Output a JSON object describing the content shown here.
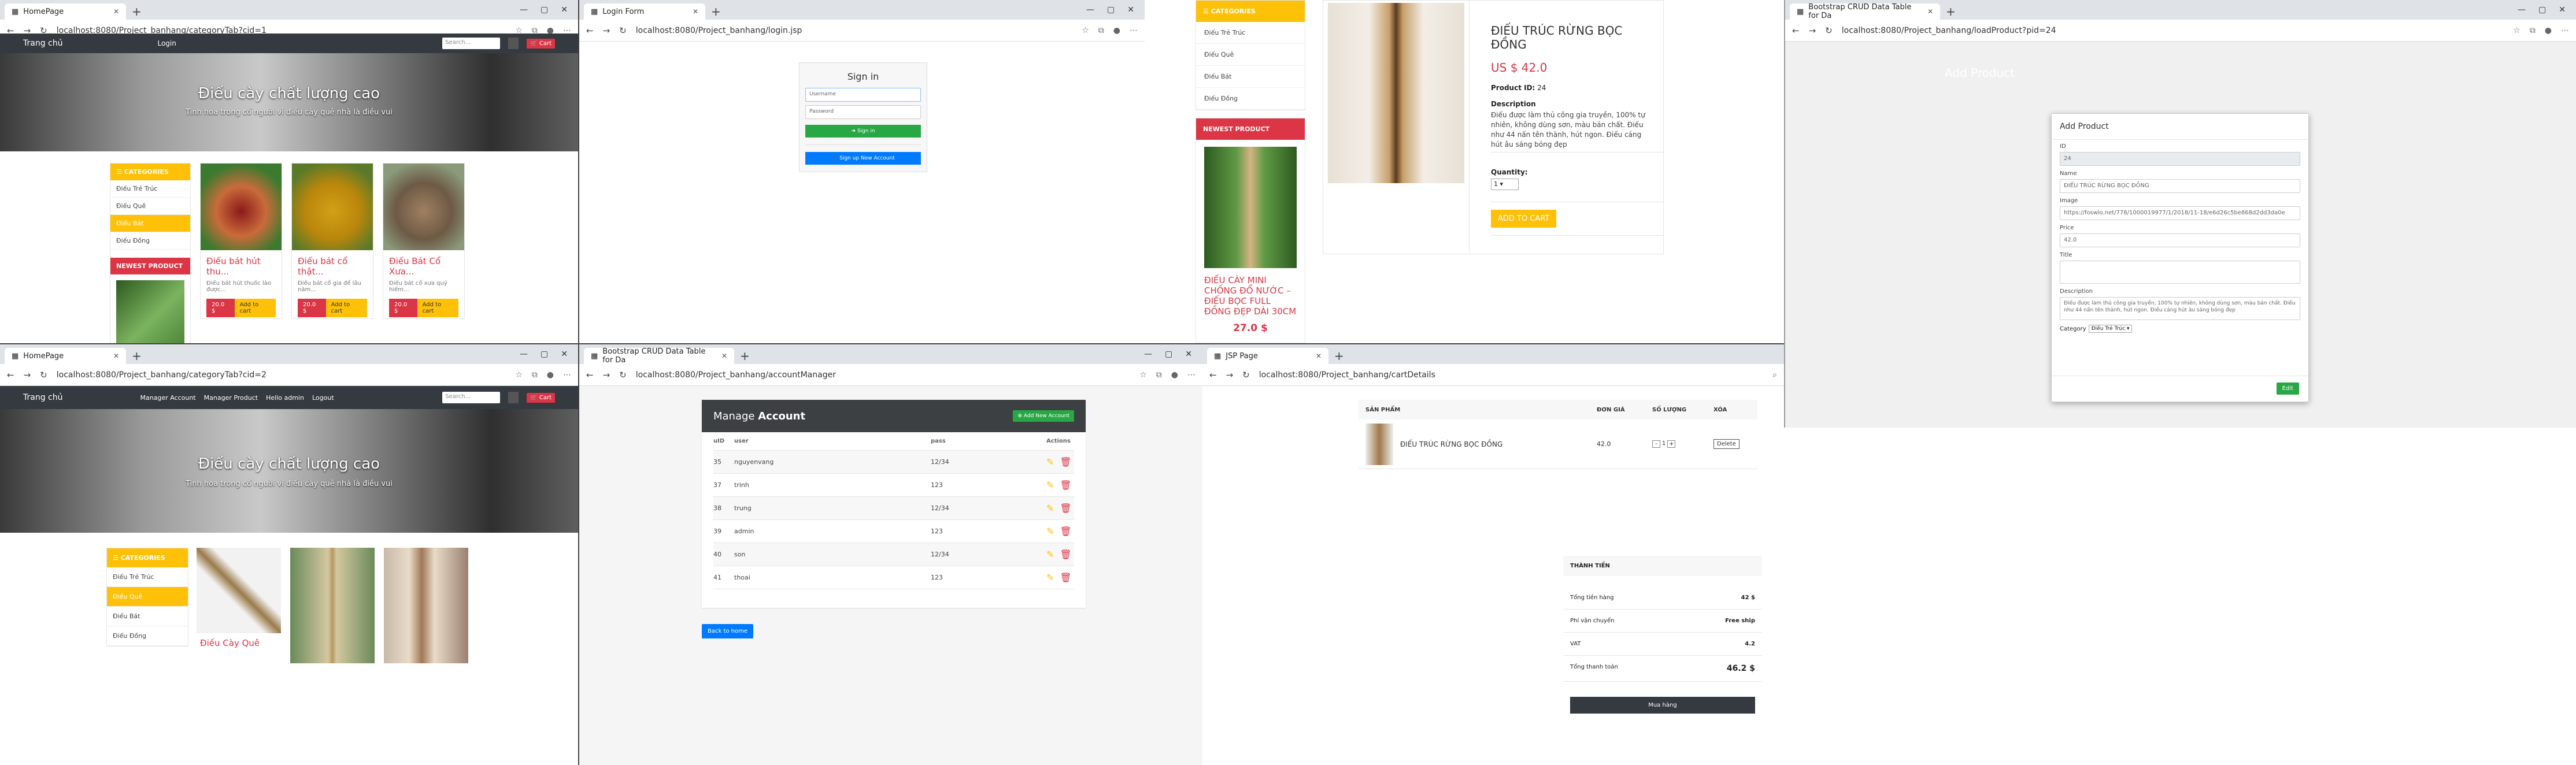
{
  "p1": {
    "tab": "HomePage",
    "url": "localhost:8080/Project_banhang/categoryTab?cid=1",
    "brand": "Trang chủ",
    "login": "Login",
    "search_ph": "Search...",
    "cart": "Cart",
    "hero_title": "Điếu cày chất lượng cao",
    "hero_sub": "Tinh hoa trong cổ người vì điếu cày quê nhà là điều vui",
    "categories_title": "CATEGORIES",
    "categories": [
      "Điếu Trẻ Trúc",
      "Điếu Quê",
      "Điếu Bát",
      "Điếu Đồng"
    ],
    "newest": "NEWEST PRODUCT",
    "products": [
      {
        "name": "Điếu bát hút thu...",
        "desc": "Điếu bát hút thuốc lào được...",
        "price": "20.0 $",
        "add": "Add to cart"
      },
      {
        "name": "Điếu bát cổ thật...",
        "desc": "Điếu bát cổ gia để lâu năm...",
        "price": "20.0 $",
        "add": "Add to cart"
      },
      {
        "name": "Điếu Bát Cổ Xưa...",
        "desc": "Điếu bát cổ xưa quý hiếm...",
        "price": "20.0 $",
        "add": "Add to cart"
      }
    ]
  },
  "p2": {
    "tab": "Login Form",
    "url": "localhost:8080/Project_banhang/login.jsp",
    "title": "Sign in",
    "username_ph": "Username",
    "password_ph": "Password",
    "signin": "Sign in",
    "signup": "Sign up New Account"
  },
  "p3": {
    "categories_title": "CATEGORIES",
    "categories": [
      "Điếu Trẻ Trúc",
      "Điếu Quê",
      "Điếu Bát",
      "Điếu Đồng"
    ],
    "newest": "NEWEST PRODUCT",
    "newest_name": "ĐIẾU CÀY MINI CHỐNG ĐỔ NƯỚC – ĐIẾU BỌC FULL ĐỒNG ĐẸP DÀI 30CM",
    "newest_price": "27.0 $",
    "title": "ĐIẾU TRÚC RỪNG BỌC ĐỒNG",
    "price": "US $ 42.0",
    "pid_label": "Product ID:",
    "pid": "24",
    "desc_label": "Description",
    "desc": "Điếu được làm thủ công gia truyền, 100% tự nhiên, không dùng sơn, màu bản chất. Điếu như 44 nấn tên thành, hút ngon. Điếu cáng hút âu sáng bóng đẹp",
    "qty_label": "Quantity:",
    "qty": "1",
    "add": "ADD TO CART"
  },
  "p4": {
    "tab": "Bootstrap CRUD Data Table for Da",
    "url": "localhost:8080/Project_banhang/loadProduct?pid=24",
    "bg_title": "Add Product",
    "modal_title": "Add Product",
    "id_label": "ID",
    "id": "24",
    "name_label": "Name",
    "name": "ĐIẾU TRÚC RỪNG BỌC ĐỒNG",
    "image_label": "Image",
    "image": "https://foswlo.net/778/1000019977/1/2018/11-18/e6d26c5be868d2dd3da0e",
    "price_label": "Price",
    "price": "42.0",
    "title_label": "Title",
    "title": "",
    "desc_label": "Description",
    "desc": "Điếu được làm thủ công gia truyền, 100% tự nhiên, không dùng sơn, màu bản chất. Điếu như 44 nấn tên thành, hút ngon. Điếu cáng hút âu sáng bóng đẹp",
    "cat_label": "Category",
    "cat": "Điếu Trẻ Trúc",
    "edit": "Edit"
  },
  "p5": {
    "tab": "HomePage",
    "url": "localhost:8080/Project_banhang/categoryTab?cid=2",
    "brand": "Trang chủ",
    "nav": [
      "Manager Account",
      "Manager Product",
      "Hello admin",
      "Logout"
    ],
    "search_ph": "Search...",
    "cart": "Cart",
    "hero_title": "Điếu cày chất lượng cao",
    "hero_sub": "Tinh hoa trong cổ người vì điếu cày quê nhà là điều vui",
    "categories_title": "CATEGORIES",
    "categories": [
      "Điếu Trẻ Trúc",
      "Điếu Quê",
      "Điếu Bát",
      "Điếu Đồng"
    ],
    "product_name": "Điếu Cày Quê"
  },
  "p6": {
    "tab": "Bootstrap CRUD Data Table for Da",
    "url": "localhost:8080/Project_banhang/accountManager",
    "title_a": "Manage ",
    "title_b": "Account",
    "add": "Add New Account",
    "headers": [
      "uID",
      "user",
      "pass",
      "Actions"
    ],
    "rows": [
      {
        "id": "35",
        "user": "nguyenvang",
        "pass": "12/34"
      },
      {
        "id": "37",
        "user": "trinh",
        "pass": "123"
      },
      {
        "id": "38",
        "user": "trung",
        "pass": "12/34"
      },
      {
        "id": "39",
        "user": "admin",
        "pass": "123"
      },
      {
        "id": "40",
        "user": "son",
        "pass": "12/34"
      },
      {
        "id": "41",
        "user": "thoai",
        "pass": "123"
      }
    ],
    "back": "Back to home"
  },
  "p7": {
    "tab": "JSP Page",
    "url": "localhost:8080/Project_banhang/cartDetails",
    "headers": [
      "SẢN PHẨM",
      "ĐƠN GIÁ",
      "SỐ LƯỢNG",
      "XÓA"
    ],
    "item": "ĐIẾU TRÚC RỪNG BỌC ĐỒNG",
    "unit": "42.0",
    "qty": "1",
    "delete": "Delete",
    "summary_title": "THÀNH TIỀN",
    "lines": [
      {
        "label": "Tổng tiền hàng",
        "value": "42 $"
      },
      {
        "label": "Phí vận chuyển",
        "value": "Free ship"
      },
      {
        "label": "VAT",
        "value": "4.2"
      },
      {
        "label": "Tổng thanh toán",
        "value": "46.2 $"
      }
    ],
    "buy": "Mua hàng"
  },
  "colors": {
    "yellow": "#ffc107",
    "red": "#dc3545",
    "dark": "#343a40",
    "green": "#28a745",
    "blue": "#007bff"
  }
}
